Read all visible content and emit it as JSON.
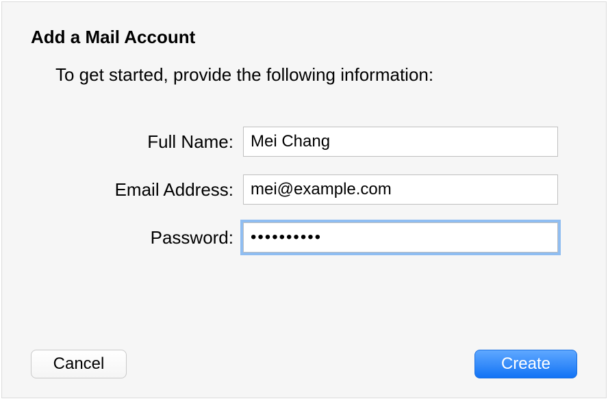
{
  "title": "Add a Mail Account",
  "subtitle": "To get started, provide the following information:",
  "form": {
    "fullName": {
      "label": "Full Name:",
      "value": "Mei Chang"
    },
    "email": {
      "label": "Email Address:",
      "value": "mei@example.com"
    },
    "password": {
      "label": "Password:",
      "mask": "••••••••••"
    }
  },
  "buttons": {
    "cancel": "Cancel",
    "create": "Create"
  }
}
